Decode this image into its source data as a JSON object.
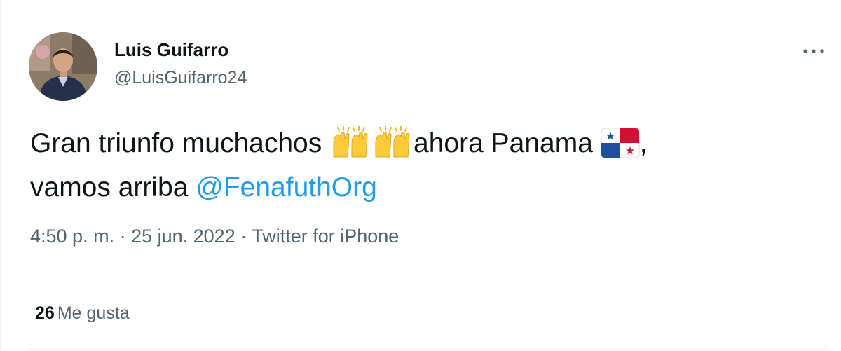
{
  "author": {
    "display_name": "Luis Guifarro",
    "handle": "@LuisGuifarro24"
  },
  "tweet": {
    "text_part1": "Gran triunfo muchachos ",
    "emoji_1": "raising-hands-emoji",
    "emoji_2": "raising-hands-emoji",
    "text_part2": "ahora Panama ",
    "emoji_3": "panama-flag-emoji",
    "text_part3": ",",
    "text_part4": "vamos arriba ",
    "mention": "@FenafuthOrg"
  },
  "meta": {
    "time": "4:50 p. m.",
    "separator": " · ",
    "date": "25 jun. 2022",
    "source": "Twitter for iPhone"
  },
  "stats": {
    "likes_count": "26",
    "likes_label": "Me gusta"
  },
  "colors": {
    "link": "#1d9bf0",
    "secondary_text": "#536471",
    "primary_text": "#0f1419",
    "divider": "#eff3f4"
  }
}
